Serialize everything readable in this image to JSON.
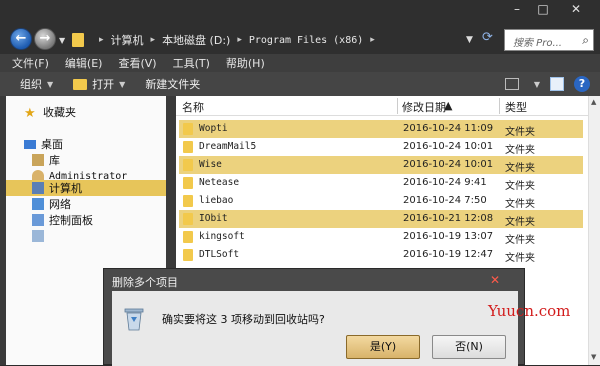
{
  "window": {
    "controls": [
      "–",
      "□",
      "✕"
    ]
  },
  "address": {
    "crumbs": [
      "计算机",
      "本地磁盘 (D:)",
      "Program Files (x86)"
    ],
    "search_placeholder": "搜索 Pro..."
  },
  "menu": [
    "文件(F)",
    "编辑(E)",
    "查看(V)",
    "工具(T)",
    "帮助(H)"
  ],
  "toolbar": {
    "organize": "组织",
    "open": "打开",
    "new_folder": "新建文件夹"
  },
  "nav": {
    "favorites": "收藏夹",
    "desktop": "桌面",
    "library": "库",
    "user": "Administrator",
    "computer": "计算机",
    "network": "网络",
    "control_panel": "控制面板"
  },
  "columns": {
    "name": "名称",
    "modified": "修改日期",
    "type": "类型"
  },
  "files": [
    {
      "name": "Wopti",
      "date": "2016-10-24 11:09",
      "type": "文件夹",
      "selected": true
    },
    {
      "name": "DreamMail5",
      "date": "2016-10-24 10:01",
      "type": "文件夹",
      "selected": false
    },
    {
      "name": "Wise",
      "date": "2016-10-24 10:01",
      "type": "文件夹",
      "selected": true
    },
    {
      "name": "Netease",
      "date": "2016-10-24 9:41",
      "type": "文件夹",
      "selected": false
    },
    {
      "name": "liebao",
      "date": "2016-10-24 7:50",
      "type": "文件夹",
      "selected": false
    },
    {
      "name": "IObit",
      "date": "2016-10-21 12:08",
      "type": "文件夹",
      "selected": true
    },
    {
      "name": "kingsoft",
      "date": "2016-10-19 13:07",
      "type": "文件夹",
      "selected": false
    },
    {
      "name": "DTLSoft",
      "date": "2016-10-19 12:47",
      "type": "文件夹",
      "selected": false
    }
  ],
  "dialog": {
    "title": "删除多个项目",
    "close": "✕",
    "message": "确实要将这 3 项移动到回收站吗?",
    "yes": "是(Y)",
    "no": "否(N)"
  },
  "watermark": "Yuucn.com",
  "colors": {
    "selection": "#ecd27e",
    "nav_selection": "#e7c55a",
    "folder": "#f2c94c",
    "watermark": "#d21c1c"
  }
}
